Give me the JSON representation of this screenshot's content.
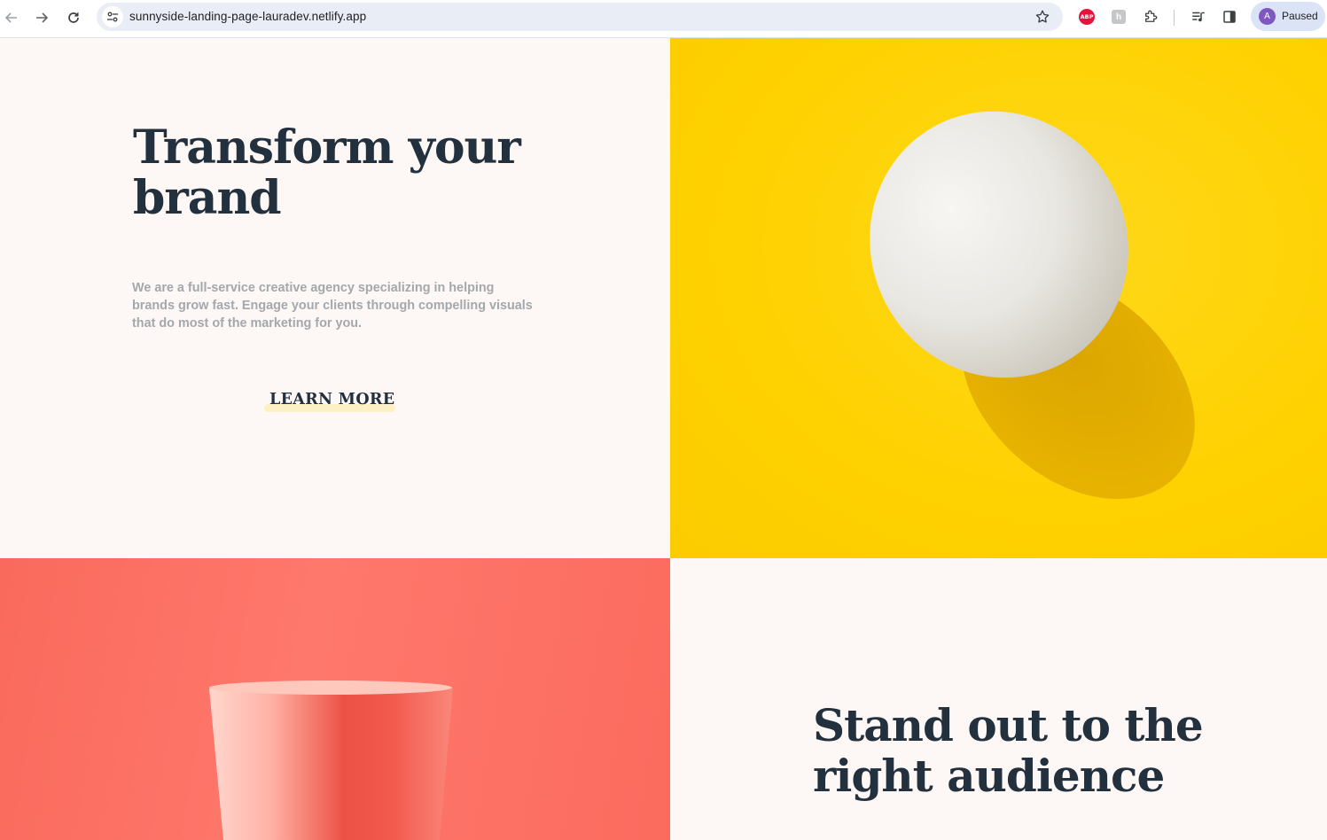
{
  "browser": {
    "url": "sunnyside-landing-page-lauradev.netlify.app",
    "profile_initial": "A",
    "profile_status": "Paused",
    "extensions": [
      "abp-icon",
      "translate-extension-icon",
      "puzzle-extensions-icon"
    ],
    "abp_label": "ABP"
  },
  "hero": {
    "title": "Transform your brand",
    "body": "We are a full-service creative agency specializing in helping brands grow fast. Engage your clients through compelling visuals that do most of the marketing for you.",
    "cta_label": "LEARN MORE",
    "cta_underline_color": "#fbf1c4"
  },
  "standout": {
    "title": "Stand out to the right audience"
  },
  "colors": {
    "background": "#fdf8f5",
    "heading": "#23303e",
    "body_text": "#a4a8ad",
    "egg_panel": "#fed100",
    "cup_panel": "#fb6b5e"
  },
  "images": {
    "egg": "egg-image",
    "cup": "cup-image"
  }
}
